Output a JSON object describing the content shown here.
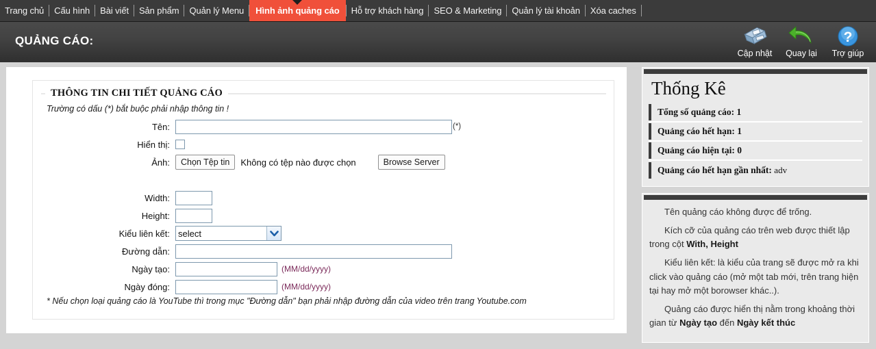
{
  "nav": {
    "items": [
      {
        "label": "Trang chủ",
        "active": false
      },
      {
        "label": "Cấu hình",
        "active": false
      },
      {
        "label": "Bài viết",
        "active": false
      },
      {
        "label": "Sản phẩm",
        "active": false
      },
      {
        "label": "Quản lý Menu",
        "active": false
      },
      {
        "label": "Hình ảnh quảng cáo",
        "active": true
      },
      {
        "label": "Hỗ trợ khách hàng",
        "active": false
      },
      {
        "label": "SEO & Marketing",
        "active": false
      },
      {
        "label": "Quản lý tài khoản",
        "active": false
      },
      {
        "label": "Xóa caches",
        "active": false
      }
    ],
    "active_color": "#f0503a",
    "bar_color": "#3b3b3b"
  },
  "header": {
    "title": "QUẢNG CÁO:",
    "tools": [
      {
        "label": "Cập nhật",
        "icon": "floppy-disk-icon"
      },
      {
        "label": "Quay lại",
        "icon": "back-arrow-icon"
      },
      {
        "label": "Trợ giúp",
        "icon": "question-mark-icon"
      }
    ]
  },
  "form": {
    "legend": "THÔNG TIN CHI TIẾT QUẢNG CÁO",
    "required_note": "Trường có dấu (*) bắt buộc phải nhập thông tin !",
    "fields": {
      "name_label": "Tên:",
      "name_value": "",
      "name_required_mark": "(*)",
      "display_label": "Hiển thị:",
      "display_checked": false,
      "image_label": "Ảnh:",
      "choose_file_button": "Chọn Tệp tin",
      "file_status": "Không có tệp nào được chọn",
      "browse_server_button": "Browse Server",
      "width_label": "Width:",
      "width_value": "",
      "height_label": "Height:",
      "height_value": "",
      "link_type_label": "Kiểu liên kết:",
      "link_type_selected": "select",
      "link_type_options": [
        "select"
      ],
      "path_label": "Đường dẫn:",
      "path_value": "",
      "created_date_label": "Ngày tạo:",
      "created_date_value": "",
      "created_date_format": "(MM/dd/yyyy)",
      "close_date_label": "Ngày đóng:",
      "close_date_value": "",
      "close_date_format": "(MM/dd/yyyy)"
    },
    "footnote": "* Nếu chọn loại quảng cáo là YouTube thì trong mục \"Đường dẫn\" bạn phải nhập đường dẫn của video trên trang Youtube.com"
  },
  "stats": {
    "title": "Thống Kê",
    "rows": [
      {
        "label": "Tổng số quảng cáo:",
        "value": "1"
      },
      {
        "label": "Quảng cáo hết hạn:",
        "value": "1"
      },
      {
        "label": "Quảng cáo hiện tại:",
        "value": "0"
      },
      {
        "label": "Quảng cáo hết hạn gần nhất:",
        "value": "adv"
      }
    ]
  },
  "help": {
    "paragraphs": [
      {
        "pre": "Tên quảng cáo không được để trống.",
        "bold": "",
        "post": ""
      },
      {
        "pre": "Kích cỡ của quảng cáo trên web được thiết lập trong cột ",
        "bold": "With, Height",
        "post": ""
      },
      {
        "pre": "Kiểu liên kết: là kiểu của trang sẽ được mở ra khi click vào quảng cáo (mở một tab mới, trên trang hiện tại hay mở một borowser khác..).",
        "bold": "",
        "post": ""
      },
      {
        "pre": "Quảng cáo được hiển thị nằm trong khoảng thời gian từ ",
        "bold": "Ngày tạo",
        "post": " đến ",
        "bold2": "Ngày kết thúc"
      }
    ]
  }
}
